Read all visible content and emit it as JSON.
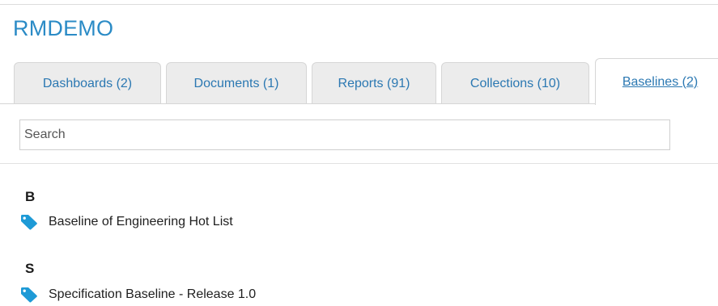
{
  "project": {
    "title": "RMDEMO"
  },
  "tabs": [
    {
      "label": "Dashboards (2)",
      "active": false
    },
    {
      "label": "Documents (1)",
      "active": false
    },
    {
      "label": "Reports (91)",
      "active": false
    },
    {
      "label": "Collections (10)",
      "active": false
    },
    {
      "label": "Baselines (2)",
      "active": true
    }
  ],
  "search": {
    "placeholder": "Search",
    "value": ""
  },
  "groups": [
    {
      "letter": "B",
      "items": [
        {
          "label": "Baseline of Engineering Hot List",
          "icon": "tag-icon"
        }
      ]
    },
    {
      "letter": "S",
      "items": [
        {
          "label": "Specification Baseline - Release 1.0",
          "icon": "tag-icon"
        }
      ]
    }
  ],
  "colors": {
    "accent": "#2b8bc6",
    "link": "#2b78b2",
    "icon": "#1e9ad6",
    "tab_bg": "#ececec"
  }
}
